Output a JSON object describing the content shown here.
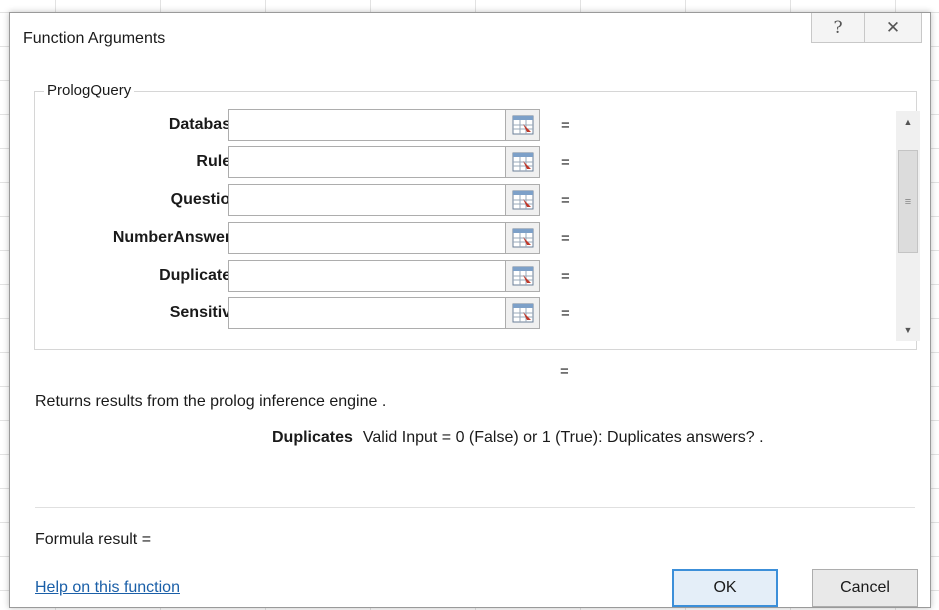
{
  "window": {
    "title": "Function Arguments",
    "help_icon": "question-mark-icon",
    "close_icon": "close-icon",
    "help_glyph": "?",
    "close_glyph": "✕"
  },
  "function_group": {
    "name": "PrologQuery",
    "arguments": [
      {
        "label": "Database",
        "value": "",
        "result": "="
      },
      {
        "label": "Rules",
        "value": "",
        "result": "="
      },
      {
        "label": "Question",
        "value": "",
        "result": "="
      },
      {
        "label": "NumberAnswers",
        "value": "",
        "result": "="
      },
      {
        "label": "Duplicates",
        "value": "",
        "result": "="
      },
      {
        "label": "Sensitive",
        "value": "",
        "result": "="
      }
    ],
    "ref_icon": "collapse-range-icon"
  },
  "function_result_eq": "=",
  "description": "Returns results from the prolog inference engine .",
  "current_argument": {
    "name": "Duplicates",
    "help": "Valid Input = 0 (False) or 1 (True): Duplicates answers? ."
  },
  "formula_result_label": "Formula result =",
  "help_link": "Help on this function",
  "buttons": {
    "ok": "OK",
    "cancel": "Cancel"
  },
  "colors": {
    "link": "#1a5fa8",
    "ok_border": "#3c8fd9"
  }
}
